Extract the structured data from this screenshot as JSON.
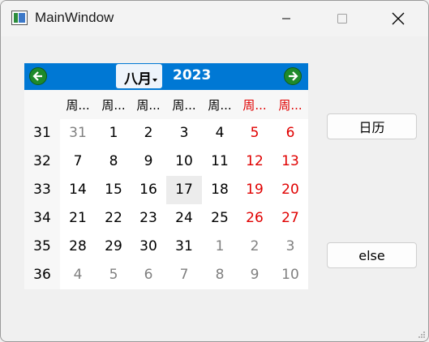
{
  "window": {
    "title": "MainWindow"
  },
  "calendar": {
    "month": "八月",
    "year": "2023",
    "weekday_headers": [
      "周...",
      "周...",
      "周...",
      "周...",
      "周...",
      "周...",
      "周..."
    ],
    "week_numbers": [
      "31",
      "32",
      "33",
      "34",
      "35",
      "36"
    ],
    "weeks": [
      [
        "31",
        "1",
        "2",
        "3",
        "4",
        "5",
        "6"
      ],
      [
        "7",
        "8",
        "9",
        "10",
        "11",
        "12",
        "13"
      ],
      [
        "14",
        "15",
        "16",
        "17",
        "18",
        "19",
        "20"
      ],
      [
        "21",
        "22",
        "23",
        "24",
        "25",
        "26",
        "27"
      ],
      [
        "28",
        "29",
        "30",
        "31",
        "1",
        "2",
        "3"
      ],
      [
        "4",
        "5",
        "6",
        "7",
        "8",
        "9",
        "10"
      ]
    ],
    "selected_date": "17",
    "colors": {
      "nav_bar": "#0078d4",
      "weekend": "#e00000",
      "other_month": "#808080",
      "nav_button": "#1e8a2b"
    }
  },
  "buttons": {
    "calendar_label": "日历",
    "else_label": "else"
  }
}
